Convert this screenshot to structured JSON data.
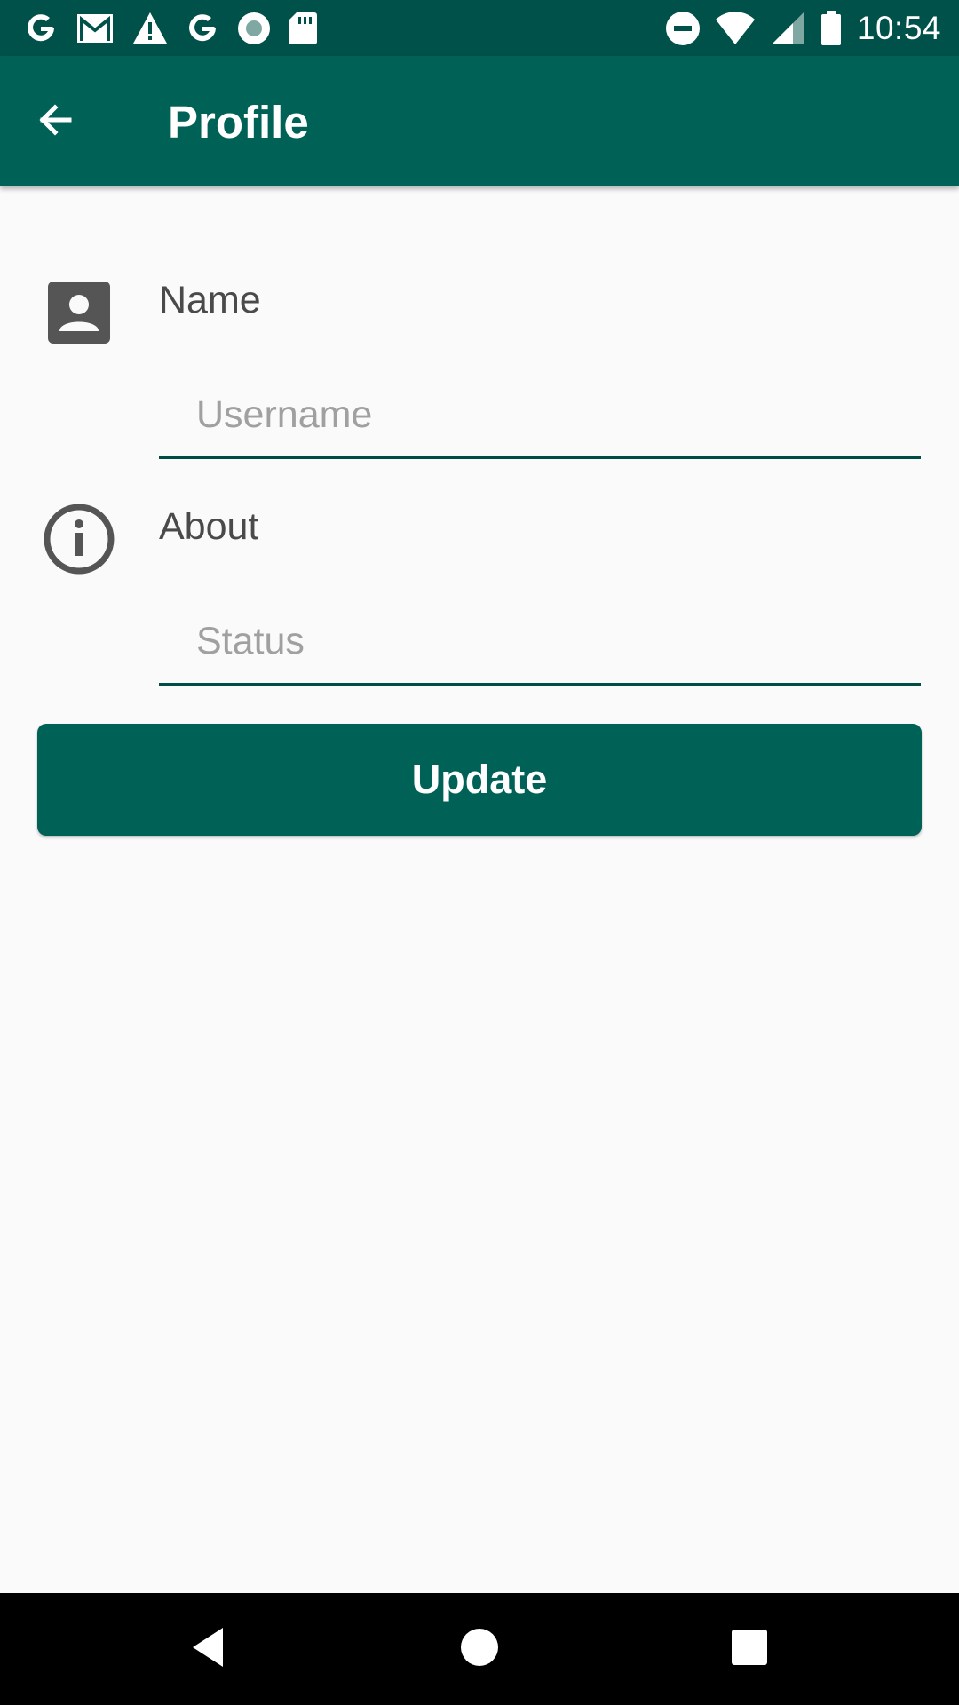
{
  "status_bar": {
    "time": "10:54",
    "left_icons": [
      "google-icon",
      "gmail-icon",
      "warning-icon",
      "google-icon",
      "record-icon",
      "sd-card-icon"
    ],
    "right_icons": [
      "do-not-disturb-icon",
      "wifi-icon",
      "cell-signal-icon",
      "battery-icon"
    ]
  },
  "app_bar": {
    "title": "Profile",
    "back_icon": "arrow-back-icon",
    "background_color": "#006257"
  },
  "form": {
    "name": {
      "label": "Name",
      "placeholder": "Username",
      "value": "",
      "icon": "contact-card-icon"
    },
    "about": {
      "label": "About",
      "placeholder": "Status",
      "value": "",
      "icon": "info-icon"
    },
    "update_button_label": "Update"
  },
  "nav_bar": {
    "buttons": [
      "back-triangle-icon",
      "home-circle-icon",
      "recents-square-icon"
    ]
  },
  "colors": {
    "status_bar": "#00514a",
    "primary": "#006257",
    "background": "#fafafa"
  }
}
